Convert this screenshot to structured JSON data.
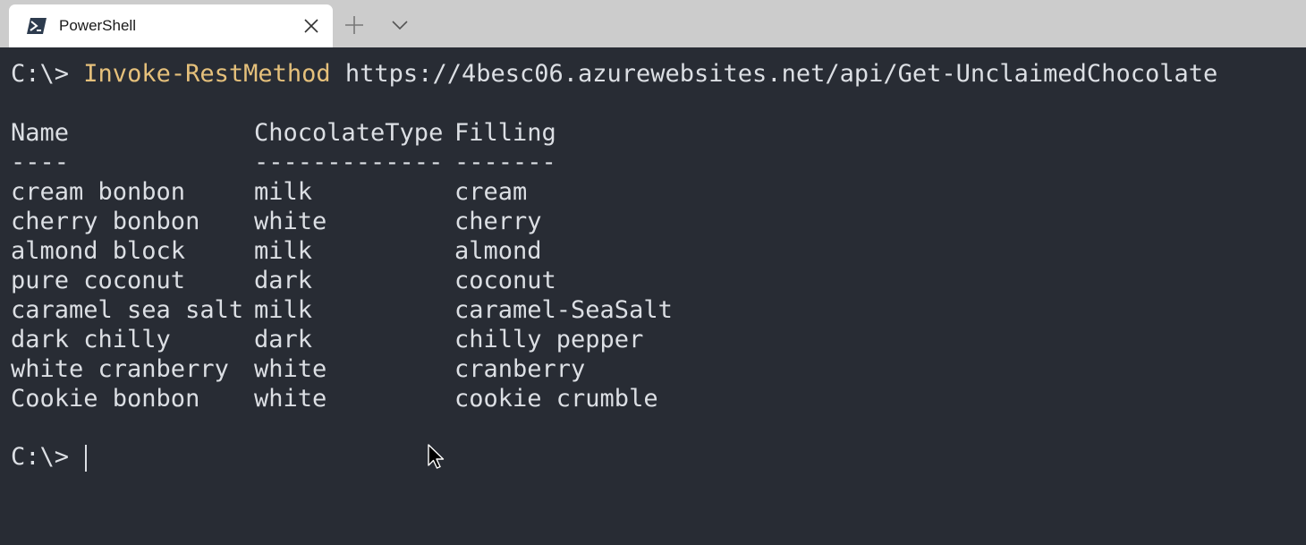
{
  "tab": {
    "title": "PowerShell",
    "icon": "powershell-icon"
  },
  "tabstrip": {
    "new_tab_icon": "plus-icon",
    "dropdown_icon": "chevron-down-icon",
    "close_icon": "close-icon"
  },
  "terminal": {
    "prompt": "C:\\>",
    "command": {
      "cmdlet": "Invoke-RestMethod",
      "url": "https://4besc06.azurewebsites.net/api/Get-UnclaimedChocolate"
    },
    "table": {
      "headers": [
        "Name",
        "ChocolateType",
        "Filling"
      ],
      "separators": [
        "----",
        "-------------",
        "-------"
      ],
      "rows": [
        [
          "cream bonbon",
          "milk",
          "cream"
        ],
        [
          "cherry bonbon",
          "white",
          "cherry"
        ],
        [
          "almond block",
          "milk",
          "almond"
        ],
        [
          "pure coconut",
          "dark",
          "coconut"
        ],
        [
          "caramel sea salt",
          "milk",
          "caramel-SeaSalt"
        ],
        [
          "dark chilly",
          "dark",
          "chilly pepper"
        ],
        [
          "white cranberry",
          "white",
          "cranberry"
        ],
        [
          "Cookie bonbon",
          "white",
          "cookie crumble"
        ]
      ]
    },
    "final_prompt": "C:\\>"
  },
  "colors": {
    "background": "#282c34",
    "foreground": "#dcdfe4",
    "command": "#e5c07b",
    "tabstrip": "#cccccc",
    "active_tab": "#ffffff"
  }
}
